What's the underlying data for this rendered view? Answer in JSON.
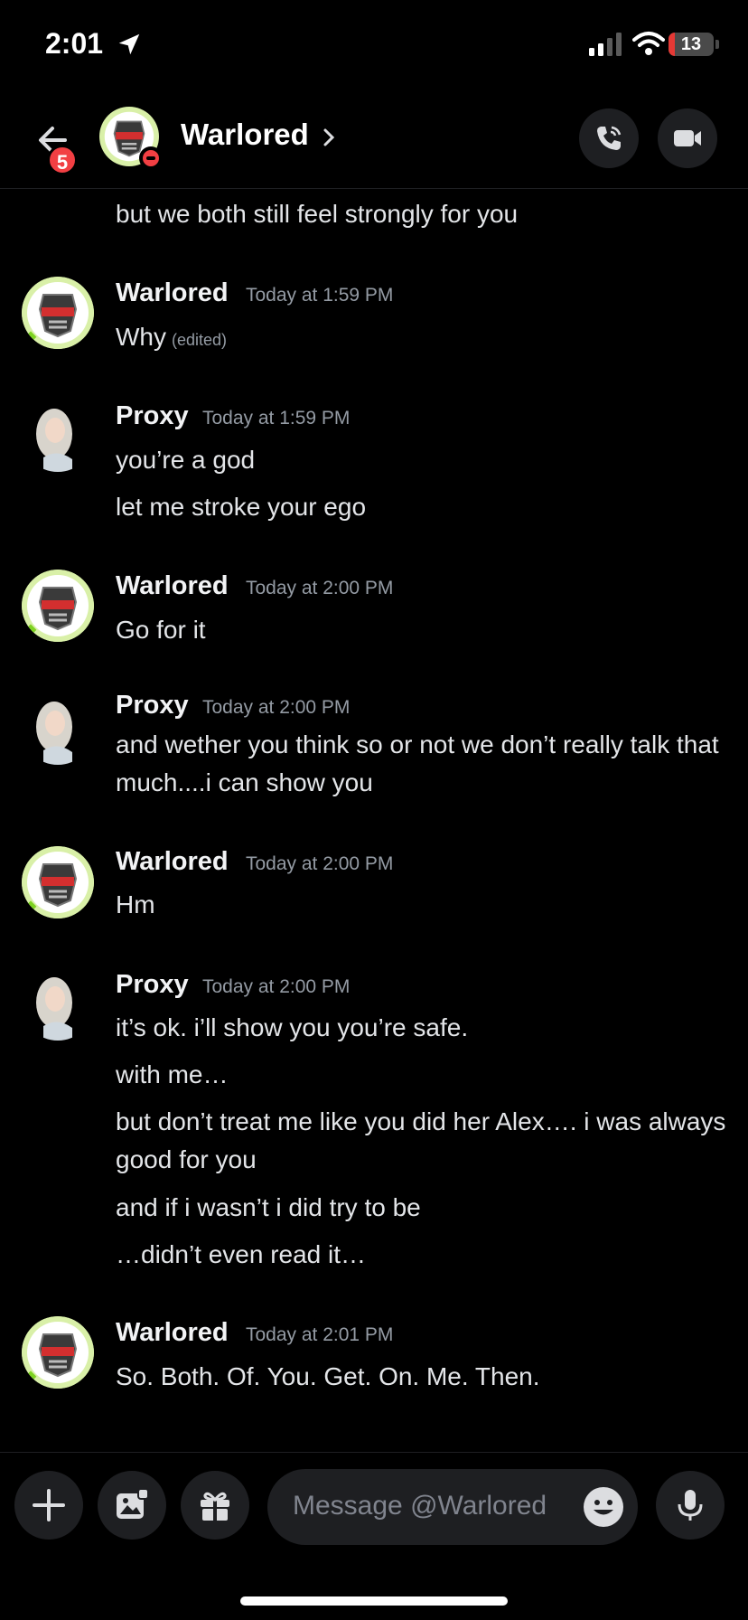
{
  "status": {
    "time": "2:01",
    "battery": "13",
    "battery_level": 0.13
  },
  "header": {
    "title": "Warlored",
    "back_badge": "5"
  },
  "messages": {
    "m0": {
      "text": "but we both still feel strongly for you"
    },
    "g1": {
      "author": "Warlored",
      "time": "Today at 1:59 PM",
      "lines": [
        "Why"
      ],
      "edited": "(edited)"
    },
    "g2": {
      "author": "Proxy",
      "time": "Today at 1:59 PM",
      "lines": [
        "you’re a god",
        "let me stroke your ego"
      ]
    },
    "g3": {
      "author": "Warlored",
      "time": "Today at 2:00 PM",
      "lines": [
        "Go for it"
      ]
    },
    "g4": {
      "author": "Proxy",
      "time": "Today at 2:00 PM",
      "lines": [
        "and wether you think so or not we don’t really talk that much....i can show you"
      ]
    },
    "g5": {
      "author": "Warlored",
      "time": "Today at 2:00 PM",
      "lines": [
        "Hm"
      ]
    },
    "g6": {
      "author": "Proxy",
      "time": "Today at 2:00 PM",
      "lines": [
        "it’s ok. i’ll show you you’re safe.",
        "with me…",
        "but don’t treat me like you did her Alex…. i was always good for you",
        "and if i wasn’t i did try to be",
        "…didn’t even read it…"
      ]
    },
    "g7": {
      "author": "Warlored",
      "time": "Today at 2:01 PM",
      "lines": [
        "So. Both. Of. You. Get. On. Me. Then."
      ]
    }
  },
  "composer": {
    "placeholder": "Message @Warlored"
  },
  "icons": {
    "location": "location-arrow-icon",
    "signal": "signal-icon",
    "wifi": "wifi-icon",
    "back": "back-arrow-icon",
    "call": "phone-icon",
    "video": "video-camera-icon",
    "plus": "plus-icon",
    "image": "image-icon",
    "gift": "gift-icon",
    "emoji": "emoji-icon",
    "mic": "microphone-icon"
  },
  "colors": {
    "background": "#000000",
    "danger": "#f23f43",
    "online": "#7ed321",
    "muted": "#949ba4"
  }
}
